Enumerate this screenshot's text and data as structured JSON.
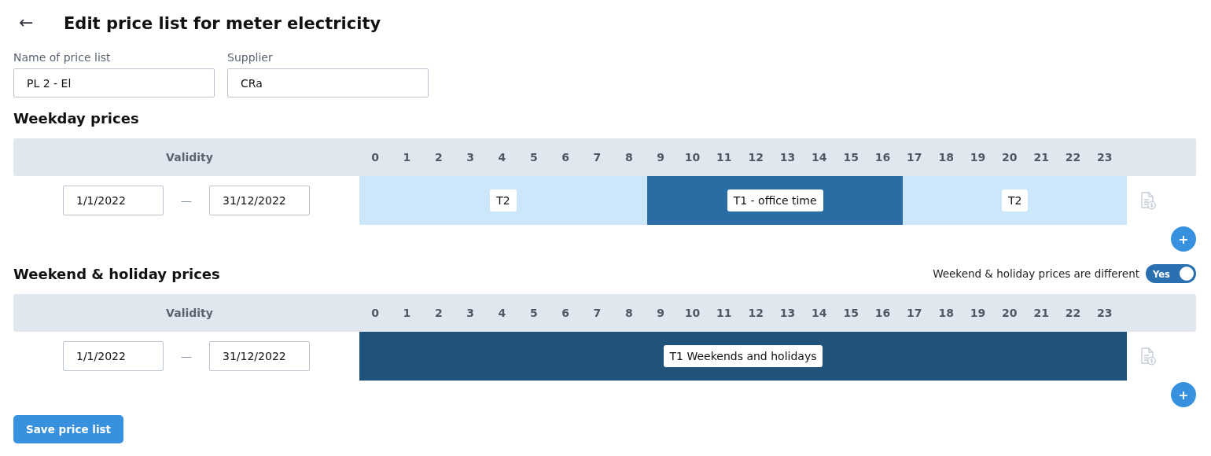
{
  "header": {
    "back": "←",
    "title": "Edit price list for meter electricity"
  },
  "fields": [
    {
      "label": "Name of price list",
      "value": "PL 2 - El"
    },
    {
      "label": "Supplier",
      "value": "CRa"
    }
  ],
  "sections": [
    {
      "title": "Weekday prices",
      "validity_heading": "Validity",
      "hours": [
        "0",
        "1",
        "2",
        "3",
        "4",
        "5",
        "6",
        "7",
        "8",
        "9",
        "10",
        "11",
        "12",
        "13",
        "14",
        "15",
        "16",
        "17",
        "18",
        "19",
        "20",
        "21",
        "22",
        "23"
      ],
      "rows": [
        {
          "from": "1/1/2022",
          "dash": "—",
          "to": "31/12/2022",
          "hour_cells": [
            {
              "color": "#cce6fa"
            },
            {
              "color": "#cce6fa"
            },
            {
              "color": "#cce6fa"
            },
            {
              "color": "#cce6fa"
            },
            {
              "color": "#cce6fa"
            },
            {
              "color": "#cce6fa"
            },
            {
              "color": "#cce6fa"
            },
            {
              "color": "#cce6fa"
            },
            {
              "color": "#cce6fa"
            },
            {
              "color": "#2a6ca4"
            },
            {
              "color": "#2a6ca4"
            },
            {
              "color": "#2a6ca4"
            },
            {
              "color": "#2a6ca4"
            },
            {
              "color": "#2a6ca4"
            },
            {
              "color": "#2a6ca4"
            },
            {
              "color": "#2a6ca4"
            },
            {
              "color": "#2a6ca4"
            },
            {
              "color": "#cce6fa"
            },
            {
              "color": "#cce6fa"
            },
            {
              "color": "#cce6fa"
            },
            {
              "color": "#cce6fa"
            },
            {
              "color": "#cce6fa"
            },
            {
              "color": "#cce6fa"
            },
            {
              "color": "#cce6fa"
            }
          ],
          "segment_labels": [
            "T2",
            "T1 - office time",
            "T2"
          ]
        }
      ],
      "add": "+"
    },
    {
      "title": "Weekend & holiday prices",
      "switch": {
        "label": "Weekend & holiday prices are different",
        "text": "Yes",
        "on": true
      },
      "validity_heading": "Validity",
      "hours": [
        "0",
        "1",
        "2",
        "3",
        "4",
        "5",
        "6",
        "7",
        "8",
        "9",
        "10",
        "11",
        "12",
        "13",
        "14",
        "15",
        "16",
        "17",
        "18",
        "19",
        "20",
        "21",
        "22",
        "23"
      ],
      "rows": [
        {
          "from": "1/1/2022",
          "dash": "—",
          "to": "31/12/2022",
          "hour_cells": [
            {
              "color": "#21527a"
            },
            {
              "color": "#21527a"
            },
            {
              "color": "#21527a"
            },
            {
              "color": "#21527a"
            },
            {
              "color": "#21527a"
            },
            {
              "color": "#21527a"
            },
            {
              "color": "#21527a"
            },
            {
              "color": "#21527a"
            },
            {
              "color": "#21527a"
            },
            {
              "color": "#21527a"
            },
            {
              "color": "#21527a"
            },
            {
              "color": "#21527a"
            },
            {
              "color": "#21527a"
            },
            {
              "color": "#21527a"
            },
            {
              "color": "#21527a"
            },
            {
              "color": "#21527a"
            },
            {
              "color": "#21527a"
            },
            {
              "color": "#21527a"
            },
            {
              "color": "#21527a"
            },
            {
              "color": "#21527a"
            },
            {
              "color": "#21527a"
            },
            {
              "color": "#21527a"
            },
            {
              "color": "#21527a"
            },
            {
              "color": "#21527a"
            }
          ],
          "segment_labels": [
            "T1 Weekends and holidays"
          ]
        }
      ],
      "add": "+"
    }
  ],
  "save": "Save price list"
}
